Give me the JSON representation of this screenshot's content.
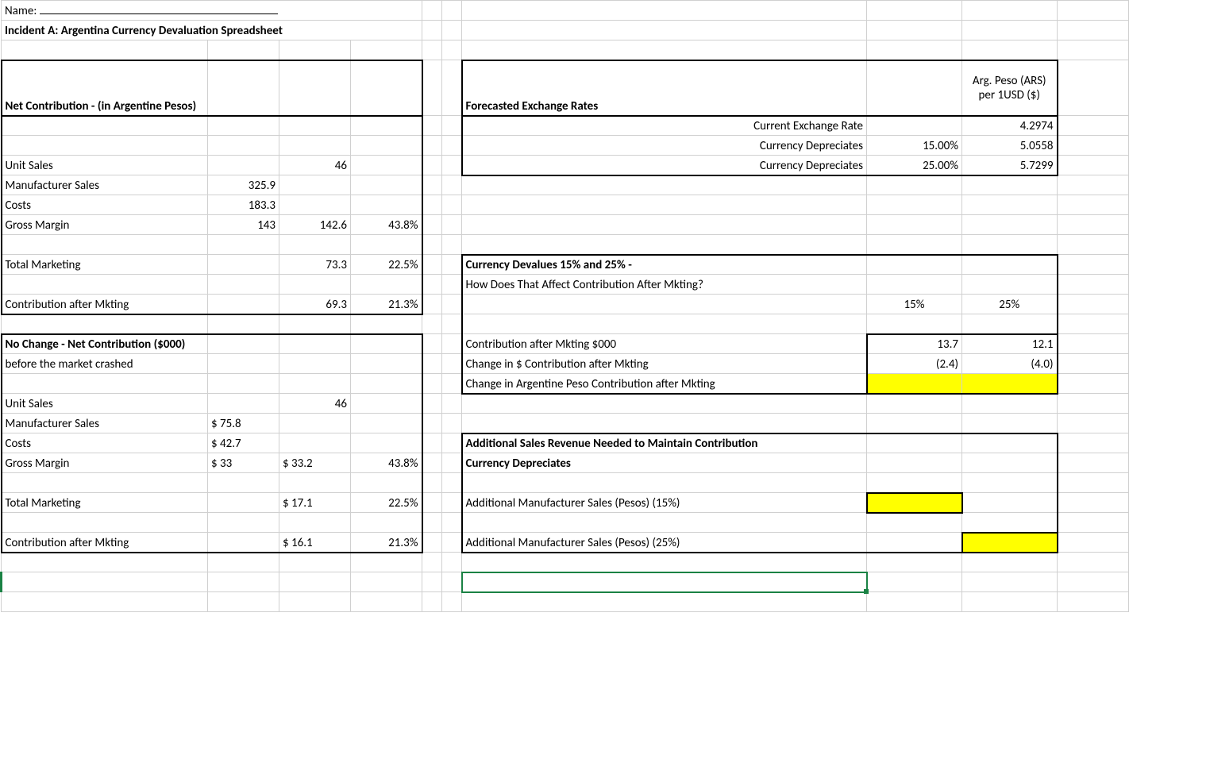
{
  "hdr": {
    "name_label": "Name:",
    "title": "Incident A: Argentina Currency Devaluation Spreadsheet"
  },
  "left": {
    "net_contrib_title": "Net Contribution - (in Argentine Pesos)",
    "unit_sales": "Unit Sales",
    "unit_sales_v": "46",
    "mfr_sales": "Manufacturer Sales",
    "mfr_sales_v": "325.9",
    "costs": "Costs",
    "costs_v": "183.3",
    "gross_margin": "Gross Margin",
    "gross_margin_b": "143",
    "gross_margin_c": "142.6",
    "gross_margin_d": "43.8%",
    "total_mkt": "Total Marketing",
    "total_mkt_c": "73.3",
    "total_mkt_d": "22.5%",
    "contrib_after": "Contribution after Mkting",
    "contrib_after_c": "69.3",
    "contrib_after_d": "21.3%",
    "no_change_title": "No Change - Net Contribution ($000)",
    "before_crash": "before the market crashed",
    "unit_sales2": "Unit Sales",
    "unit_sales2_v": "46",
    "mfr_sales2": "Manufacturer Sales",
    "mfr_sales2_v": "$    75.8",
    "costs2": "Costs",
    "costs2_v": "$    42.7",
    "gross_margin2": "Gross Margin",
    "gm2_b": "$       33",
    "gm2_c": "$    33.2",
    "gm2_d": "43.8%",
    "total_mkt2": "Total Marketing",
    "tm2_c": "$    17.1",
    "tm2_d": "22.5%",
    "contrib_after2": "Contribution after Mkting",
    "ca2_c": "$    16.1",
    "ca2_d": "21.3%"
  },
  "right": {
    "fx_title": "Forecasted Exchange Rates",
    "fx_col_hdr": "Arg. Peso (ARS) per 1USD ($)",
    "cur_rate_lbl": "Current Exchange Rate",
    "cur_rate_v": "4.2974",
    "dep15_lbl": "Currency Depreciates",
    "dep15_pct": "15.00%",
    "dep15_v": "5.0558",
    "dep25_lbl": "Currency Depreciates",
    "dep25_pct": "25.00%",
    "dep25_v": "5.7299",
    "devalue_title": "Currency Devalues 15% and 25% -",
    "devalue_sub": "How Does That Affect Contribution After Mkting?",
    "col15": "15%",
    "col25": "25%",
    "cam_lbl": "Contribution after Mkting $000",
    "cam_15": "13.7",
    "cam_25": "12.1",
    "chg_usd_lbl": "Change in $ Contribution after Mkting",
    "chg_usd_15": "(2.4)",
    "chg_usd_25": "(4.0)",
    "chg_ars_lbl": "Change in Argentine Peso Contribution after Mkting",
    "add_sales_title": "Additional Sales Revenue Needed to Maintain Contribution",
    "add_sales_sub": "Currency Depreciates",
    "add_mfr_15": "Additional Manufacturer Sales (Pesos) (15%)",
    "add_mfr_25": "Additional Manufacturer Sales (Pesos) (25%)"
  }
}
